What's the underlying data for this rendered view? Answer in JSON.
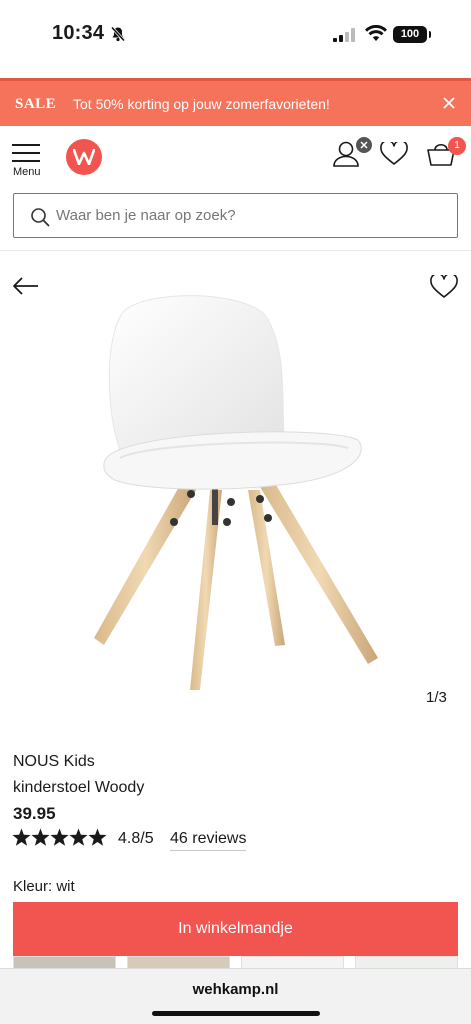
{
  "status": {
    "time": "10:34",
    "battery": "100"
  },
  "sale_banner": {
    "tag": "SALE",
    "text": "Tot 50% korting op jouw zomerfavorieten!"
  },
  "header": {
    "menu_label": "Menu",
    "cart_count": "1"
  },
  "search": {
    "placeholder": "Waar ben je naar op zoek?",
    "value": ""
  },
  "gallery": {
    "counter": "1/3"
  },
  "product": {
    "brand": "NOUS Kids",
    "name": "kinderstoel Woody",
    "price": "39.95",
    "rating_stars": 5,
    "rating": "4.8/5",
    "reviews": "46 reviews",
    "color_label": "Kleur: wit"
  },
  "cta": {
    "label": "In winkelmandje"
  },
  "browser": {
    "url": "wehkamp.nl"
  },
  "colors": {
    "accent": "#f2554f",
    "sale": "#f5735a"
  }
}
